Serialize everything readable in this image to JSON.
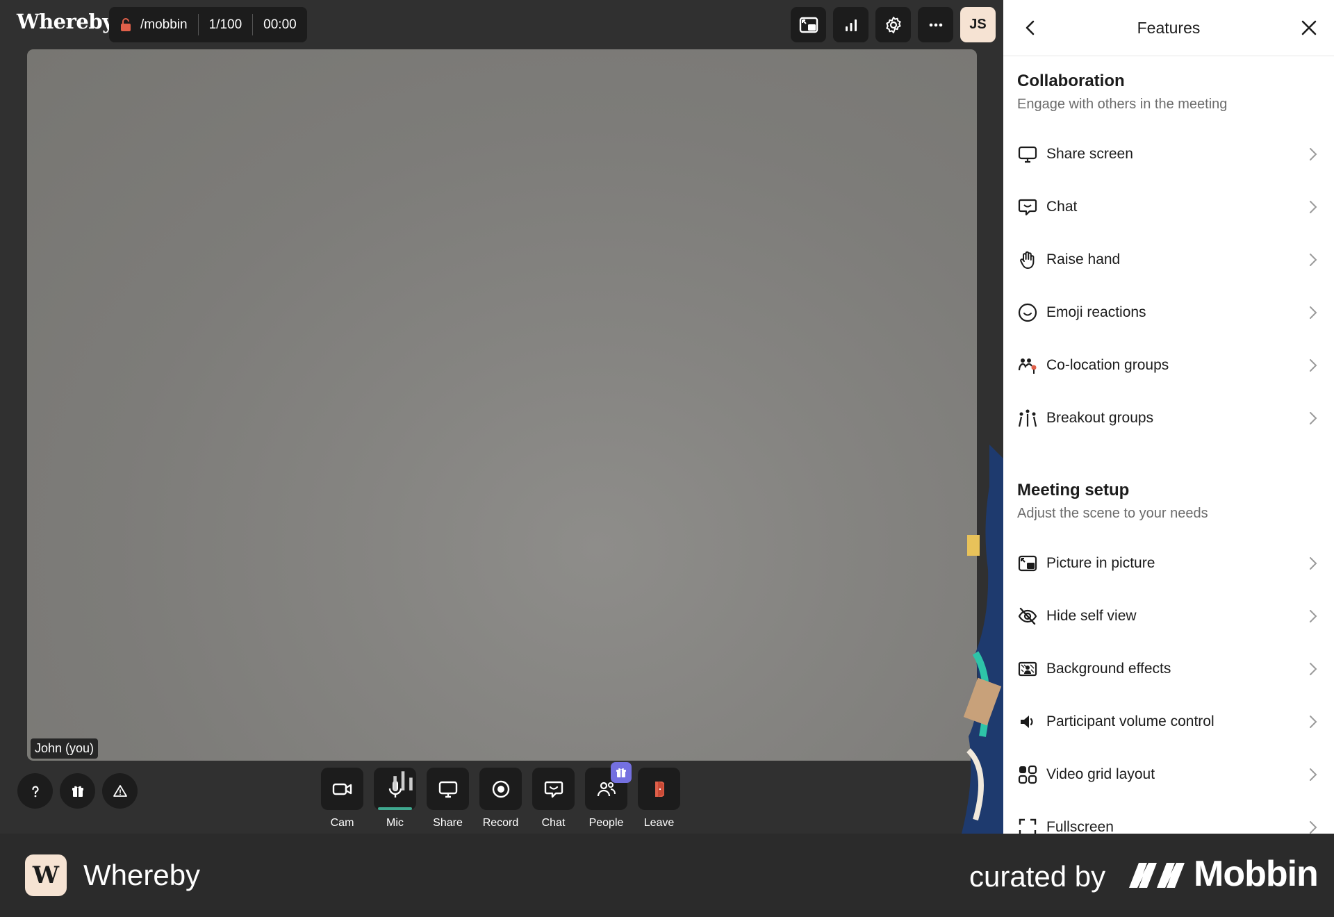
{
  "app": {
    "logo": "Whereby"
  },
  "room": {
    "name": "/mobbin",
    "participants": "1/100",
    "timer": "00:00"
  },
  "top_actions": [
    {
      "icon": "picture-in-picture-icon"
    },
    {
      "icon": "signal-bars-icon"
    },
    {
      "icon": "gear-icon"
    },
    {
      "icon": "more-icon"
    }
  ],
  "avatar": {
    "initials": "JS"
  },
  "video": {
    "name_tag": "John (you)"
  },
  "toolbar": {
    "cam": "Cam",
    "mic": "Mic",
    "share": "Share",
    "record": "Record",
    "chat": "Chat",
    "people": "People",
    "leave": "Leave"
  },
  "panel": {
    "title": "Features",
    "collaboration": {
      "title": "Collaboration",
      "subtitle": "Engage with others in the meeting",
      "items": [
        {
          "label": "Share screen",
          "icon": "monitor-icon"
        },
        {
          "label": "Chat",
          "icon": "chat-bubble-icon"
        },
        {
          "label": "Raise hand",
          "icon": "hand-icon"
        },
        {
          "label": "Emoji reactions",
          "icon": "smiley-icon"
        },
        {
          "label": "Co-location groups",
          "icon": "people-pin-icon"
        },
        {
          "label": "Breakout groups",
          "icon": "breakout-icon"
        }
      ]
    },
    "setup": {
      "title": "Meeting setup",
      "subtitle": "Adjust the scene to your needs",
      "items": [
        {
          "label": "Picture in picture",
          "icon": "picture-in-picture-icon"
        },
        {
          "label": "Hide self view",
          "icon": "eye-off-icon"
        },
        {
          "label": "Background effects",
          "icon": "background-icon"
        },
        {
          "label": "Participant volume control",
          "icon": "speaker-icon"
        },
        {
          "label": "Video grid layout",
          "icon": "grid-icon"
        },
        {
          "label": "Fullscreen",
          "icon": "fullscreen-icon"
        }
      ]
    }
  },
  "footer": {
    "app_name": "Whereby",
    "curated": "curated by",
    "brand": "Mobbin"
  },
  "colors": {
    "accent_mic": "#3fa88f",
    "badge": "#7470e0",
    "leave": "#e0604a",
    "avatar_bg": "#f6e3d3"
  }
}
